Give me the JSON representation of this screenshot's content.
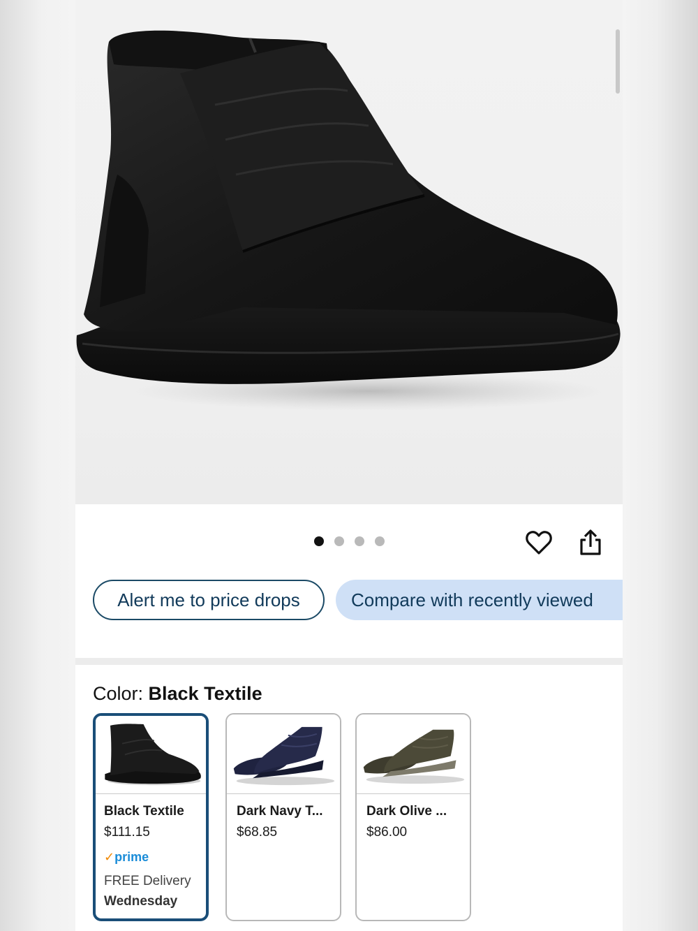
{
  "product": {
    "image_dots": {
      "count": 4,
      "active_index": 0
    },
    "actions": {
      "wishlist_icon": "heart-outline-icon",
      "share_icon": "share-icon"
    }
  },
  "buttons": {
    "price_alert": "Alert me to price drops",
    "compare": "Compare with recently viewed"
  },
  "color": {
    "label": "Color:",
    "selected": "Black Textile",
    "options": [
      {
        "name": "Black Textile",
        "price": "$111.15",
        "prime": "prime",
        "delivery": "FREE Delivery",
        "day": "Wednesday",
        "selected": true,
        "color": "#1a1a1a"
      },
      {
        "name": "Dark Navy T...",
        "price": "$68.85",
        "color": "#262a4a"
      },
      {
        "name": "Dark Olive ...",
        "price": "$86.00",
        "color": "#4c4a38"
      }
    ]
  },
  "colors": {
    "accent_border": "#1a4e78",
    "pill_fill": "#cfe0f6",
    "prime_blue": "#1a8cd8",
    "prime_check": "#f08804"
  }
}
